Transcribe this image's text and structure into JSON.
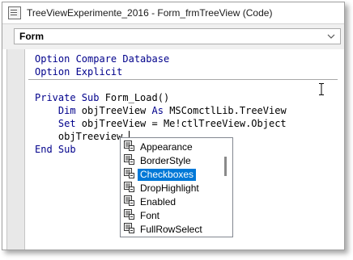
{
  "window": {
    "title": "TreeViewExperimente_2016 - Form_frmTreeView (Code)",
    "object_combo_value": "Form"
  },
  "code": {
    "lines": [
      [
        {
          "t": "Option Compare Database",
          "c": "kw"
        }
      ],
      [
        {
          "t": "Option Explicit",
          "c": "kw"
        }
      ],
      [],
      [
        {
          "t": "Private Sub ",
          "c": "kw"
        },
        {
          "t": "Form_Load()",
          "c": "plain"
        }
      ],
      [
        {
          "t": "    Dim ",
          "c": "kw"
        },
        {
          "t": "objTreeView ",
          "c": "plain"
        },
        {
          "t": "As ",
          "c": "kw"
        },
        {
          "t": "MSComctlLib.TreeView",
          "c": "plain"
        }
      ],
      [
        {
          "t": "    Set ",
          "c": "kw"
        },
        {
          "t": "objTreeView = Me!ctlTreeView.Object",
          "c": "plain"
        }
      ],
      [
        {
          "t": "    objTreeview.",
          "c": "plain"
        }
      ],
      [
        {
          "t": "End Sub",
          "c": "kw"
        }
      ]
    ]
  },
  "intellisense": {
    "items": [
      "Appearance",
      "BorderStyle",
      "Checkboxes",
      "DropHighlight",
      "Enabled",
      "Font",
      "FullRowSelect"
    ],
    "selected_index": 2,
    "icon": "property-icon"
  },
  "colors": {
    "keyword": "#00008b",
    "selection": "#0078d7"
  }
}
